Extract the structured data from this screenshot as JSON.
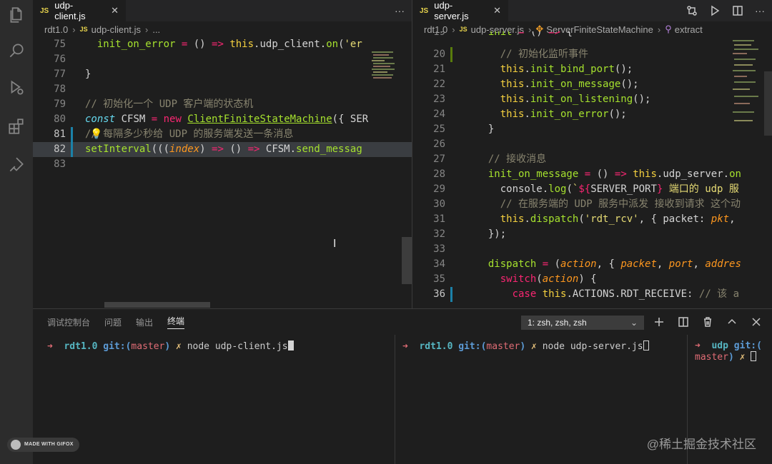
{
  "activity": [
    "explorer-icon",
    "search-icon",
    "run-debug-icon",
    "extensions-icon",
    "remote-icon"
  ],
  "left": {
    "tab": {
      "badge": "JS",
      "label": "udp-client.js",
      "close": "✕"
    },
    "more": "···",
    "crumbs": {
      "folder": "rdt1.0",
      "badge": "JS",
      "file": "udp-client.js",
      "rest": "..."
    },
    "lines": [
      {
        "n": "75",
        "code": "  init_on_error = () => this.udp_client.on('er"
      },
      {
        "n": "76",
        "code": ""
      },
      {
        "n": "77",
        "code": "}"
      },
      {
        "n": "78",
        "code": ""
      },
      {
        "n": "79",
        "code": "// 初始化一个 UDP 客户端的状态机"
      },
      {
        "n": "80",
        "code": "const CFSM = new ClientFiniteStateMachine({ SER"
      },
      {
        "n": "81",
        "code": "// 每隔多少秒给 UDP 的服务端发送一条消息"
      },
      {
        "n": "82",
        "code": "setInterval(((index) => () => CFSM.send_messag"
      },
      {
        "n": "83",
        "code": ""
      }
    ]
  },
  "right": {
    "tab": {
      "badge": "JS",
      "label": "udp-server.js",
      "close": "✕"
    },
    "crumbs": {
      "folder": "rdt1.0",
      "badge": "JS",
      "file": "udp-server.js",
      "cls": "ServerFiniteStateMachine",
      "method": "extract"
    },
    "lines": [
      {
        "n": "20",
        "code": "    // 初始化监听事件"
      },
      {
        "n": "21",
        "code": "    this.init_bind_port();"
      },
      {
        "n": "22",
        "code": "    this.init_on_message();"
      },
      {
        "n": "23",
        "code": "    this.init_on_listening();"
      },
      {
        "n": "24",
        "code": "    this.init_on_error();"
      },
      {
        "n": "25",
        "code": "  }"
      },
      {
        "n": "26",
        "code": ""
      },
      {
        "n": "27",
        "code": "  // 接收消息"
      },
      {
        "n": "28",
        "code": "  init_on_message = () => this.udp_server.on"
      },
      {
        "n": "29",
        "code": "    console.log(`${SERVER_PORT} 端口的 udp 服"
      },
      {
        "n": "30",
        "code": "    // 在服务端的 UDP 服务中派发 接收到请求 这个动"
      },
      {
        "n": "31",
        "code": "    this.dispatch('rdt_rcv', { packet: pkt,"
      },
      {
        "n": "32",
        "code": "  });"
      },
      {
        "n": "33",
        "code": ""
      },
      {
        "n": "34",
        "code": "  dispatch = (action, { packet, port, addres"
      },
      {
        "n": "35",
        "code": "    switch(action) {"
      },
      {
        "n": "36",
        "code": "      case this.ACTIONS.RDT_RECEIVE: // 该 a"
      }
    ]
  },
  "panel": {
    "tabs": [
      "调试控制台",
      "问题",
      "输出",
      "终端"
    ],
    "active_tab": "终端",
    "terminal_select": "1: zsh, zsh, zsh",
    "chevron": "⌄",
    "terminals": [
      {
        "arrow": "➜",
        "dir": "rdt1.0",
        "git": "git:(",
        "branch": "master",
        "close": ")",
        "mark": "✗",
        "cmd": "node udp-client.js"
      },
      {
        "arrow": "➜",
        "dir": "rdt1.0",
        "git": "git:(",
        "branch": "master",
        "close": ")",
        "mark": "✗",
        "cmd": "node udp-server.js"
      },
      {
        "arrow": "➜",
        "dir": "udp",
        "git": "git:(",
        "branch": "master",
        "close": ")",
        "mark": "✗",
        "cmd": ""
      }
    ]
  },
  "gifox": "MADE WITH GIFOX",
  "watermark": "@稀土掘金技术社区",
  "colors": {
    "accent": "#1b81a8",
    "keyword": "#f92672",
    "function": "#a6e22e",
    "string": "#e6db74"
  }
}
